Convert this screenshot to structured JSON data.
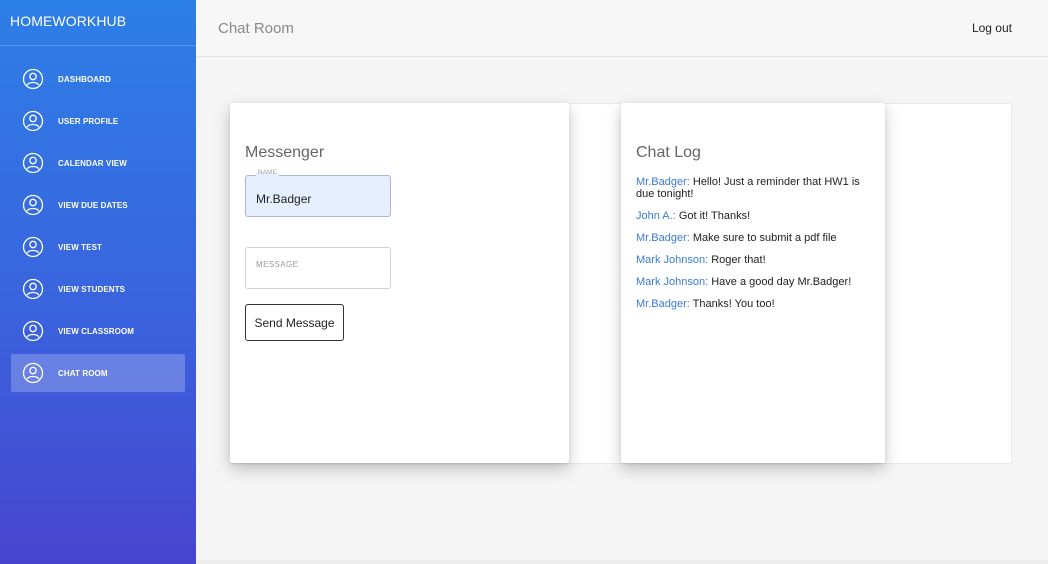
{
  "sidebar": {
    "brand": "HOMEWORKHUB",
    "items": [
      {
        "label": "DASHBOARD",
        "icon": "user-circle-icon",
        "active": false
      },
      {
        "label": "USER PROFILE",
        "icon": "user-circle-icon",
        "active": false
      },
      {
        "label": "CALENDAR VIEW",
        "icon": "user-circle-icon",
        "active": false
      },
      {
        "label": "VIEW DUE DATES",
        "icon": "user-circle-icon",
        "active": false
      },
      {
        "label": "VIEW TEST",
        "icon": "user-circle-icon",
        "active": false
      },
      {
        "label": "VIEW STUDENTS",
        "icon": "user-circle-icon",
        "active": false
      },
      {
        "label": "VIEW CLASSROOM",
        "icon": "user-circle-icon",
        "active": false
      },
      {
        "label": "CHAT ROOM",
        "icon": "user-circle-icon",
        "active": true
      }
    ]
  },
  "header": {
    "title": "Chat Room",
    "logout_label": "Log out"
  },
  "messenger": {
    "title": "Messenger",
    "name_label": "NAME",
    "name_value": "Mr.Badger",
    "message_placeholder": "MESSAGE",
    "message_value": "",
    "send_label": "Send Message"
  },
  "chat_log": {
    "title": "Chat Log",
    "messages": [
      {
        "sender": "Mr.Badger:",
        "text": "Hello! Just a reminder that HW1 is due tonight!"
      },
      {
        "sender": "John A.:",
        "text": "Got it! Thanks!"
      },
      {
        "sender": "Mr.Badger:",
        "text": "Make sure to submit a pdf file"
      },
      {
        "sender": "Mark Johnson:",
        "text": "Roger that!"
      },
      {
        "sender": "Mark Johnson:",
        "text": "Have a good day Mr.Badger!"
      },
      {
        "sender": "Mr.Badger:",
        "text": "Thanks! You too!"
      }
    ]
  },
  "colors": {
    "sidebar_gradient_top": "#2d7fe6",
    "sidebar_gradient_bottom": "#4745cf",
    "sender_blue": "#3b7ad6",
    "name_field_bg": "#e6efff"
  }
}
